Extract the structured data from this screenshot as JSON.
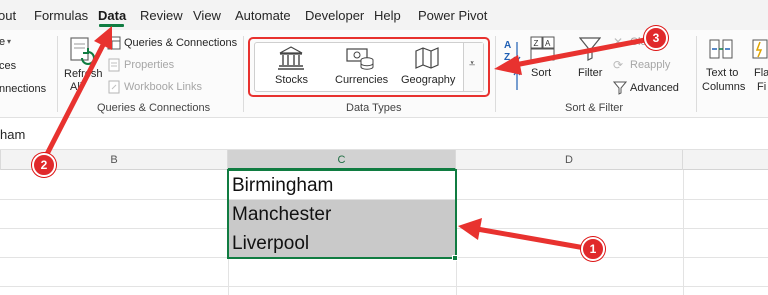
{
  "menubar": {
    "tabs": [
      "out",
      "Formulas",
      "Data",
      "Review",
      "View",
      "Automate",
      "Developer",
      "Help",
      "Power Pivot"
    ],
    "active_tab": "Data"
  },
  "ribbon": {
    "partial_items": [
      "e",
      "ces",
      "nnections"
    ],
    "queries": {
      "refresh_label_1": "Refresh",
      "refresh_label_2": "All",
      "queries_connections": "Queries & Connections",
      "properties": "Properties",
      "workbook_links": "Workbook Links",
      "group_label": "Queries & Connections"
    },
    "data_types": {
      "items": [
        "Stocks",
        "Currencies",
        "Geography"
      ],
      "more_glyph": "⩡",
      "group_label": "Data Types"
    },
    "sort_filter": {
      "sort_az_top": "A",
      "sort_az_bottom": "Z",
      "sort": "Sort",
      "filter": "Filter",
      "clear": "Clear",
      "reapply": "Reapply",
      "advanced": "Advanced",
      "group_label": "Sort & Filter"
    },
    "text_to_columns_1": "Text to",
    "text_to_columns_2": "Columns",
    "flash_fill_1": "Fla",
    "flash_fill_2": "Fi"
  },
  "formula_bar": {
    "value": "ham"
  },
  "grid": {
    "columns": [
      "B",
      "C",
      "D"
    ],
    "selected_column": "C",
    "cells": [
      "Birmingham",
      "Manchester",
      "Liverpool"
    ]
  },
  "callouts": [
    "1",
    "2",
    "3"
  ],
  "colors": {
    "accent": "#107c41",
    "callout": "#e0292b"
  }
}
